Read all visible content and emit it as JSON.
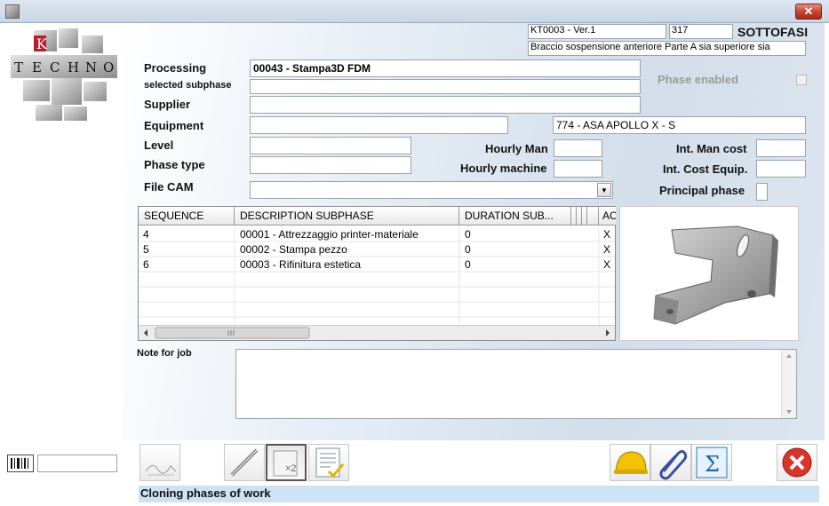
{
  "header": {
    "code_version": "KT0003 - Ver.1",
    "number": "317",
    "section": "SOTTOFASI",
    "description": "Braccio sospensione anteriore Parte A sia superiore sia"
  },
  "logo": {
    "text_top": "K",
    "text_row": [
      "T",
      "E",
      "C",
      "H",
      "N",
      "O"
    ]
  },
  "form": {
    "processing_label": "Processing",
    "processing_value": "00043 - Stampa3D FDM",
    "selected_subphase_label": "selected subphase",
    "selected_subphase_value": "",
    "supplier_label": "Supplier",
    "supplier_value": "",
    "equipment_label": "Equipment",
    "equipment_value": "",
    "equipment_desc": "774 - ASA APOLLO X - S",
    "level_label": "Level",
    "level_value": "",
    "phase_type_label": "Phase type",
    "phase_type_value": "",
    "file_cam_label": "File CAM",
    "file_cam_value": "",
    "phase_enabled_label": "Phase enabled",
    "hourly_man_label": "Hourly Man",
    "hourly_man_value": "",
    "hourly_machine_label": "Hourly machine",
    "hourly_machine_value": "",
    "int_man_cost_label": "Int. Man cost",
    "int_man_cost_value": "",
    "int_cost_equip_label": "Int. Cost Equip.",
    "int_cost_equip_value": "",
    "principal_phase_label": "Principal phase",
    "note_label": "Note for job",
    "note_value": ""
  },
  "grid": {
    "columns": [
      "SEQUENCE",
      "DESCRIPTION SUBPHASE",
      "DURATION SUB...",
      "AC"
    ],
    "rows": [
      {
        "seq": "4",
        "desc": "00001 - Attrezzaggio printer-materiale",
        "dur": "0",
        "ac": "X"
      },
      {
        "seq": "5",
        "desc": "00002 - Stampa pezzo",
        "dur": "0",
        "ac": "X"
      },
      {
        "seq": "6",
        "desc": "00003 - Rifinitura estetica",
        "dur": "0",
        "ac": "X"
      }
    ]
  },
  "toolbar": {
    "barcode_value": "",
    "multiply_label": "×2",
    "sum_label": "Σ"
  },
  "status": {
    "text": "Cloning phases of work"
  },
  "icons": [
    "app-icon",
    "close-icon",
    "barcode-icon",
    "signature-icon",
    "pen-icon",
    "multiply-icon",
    "checklist-icon",
    "helmet-icon",
    "paperclip-icon",
    "sum-icon",
    "exit-icon",
    "dropdown-arrow-icon"
  ],
  "colors": {
    "status_bg": "#cfe2f3",
    "close_red": "#c3412f",
    "panel_blue": "#d3deea"
  }
}
